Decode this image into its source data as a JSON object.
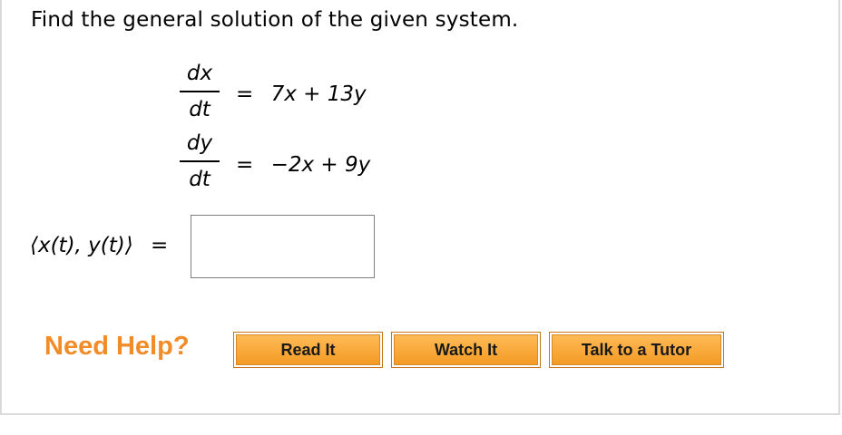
{
  "question": {
    "prompt": "Find the general solution of the given system."
  },
  "equations": [
    {
      "num": "dx",
      "den": "dt",
      "equals": "=",
      "rhs": "7x + 13y"
    },
    {
      "num": "dy",
      "den": "dt",
      "equals": "=",
      "rhs": "−2x + 9y"
    }
  ],
  "answer": {
    "label": "⟨x(t), y(t)⟩",
    "equals": "=",
    "value": ""
  },
  "help": {
    "title": "Need Help?",
    "buttons": [
      "Read It",
      "Watch It",
      "Talk to a Tutor"
    ]
  }
}
